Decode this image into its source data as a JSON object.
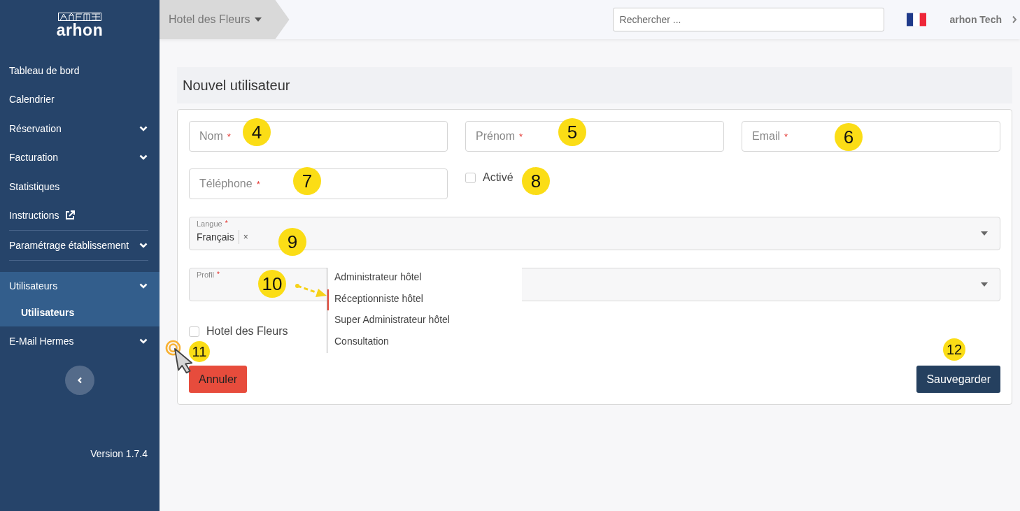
{
  "sidebar": {
    "logo": "arhon",
    "items": [
      {
        "label": "Tableau de bord"
      },
      {
        "label": "Calendrier"
      },
      {
        "label": "Réservation",
        "submenu": true,
        "expanded": false
      },
      {
        "label": "Facturation",
        "submenu": true,
        "expanded": false
      },
      {
        "label": "Statistiques"
      },
      {
        "label": "Instructions",
        "external": true
      },
      {
        "label": "Paramétrage établissement",
        "submenu": true,
        "divider_before": true,
        "expanded": false
      },
      {
        "label": "Utilisateurs",
        "submenu": true,
        "divider_before": true,
        "expanded": true,
        "children": [
          {
            "label": "Utilisateurs",
            "selected": true
          }
        ]
      },
      {
        "label": "E-Mail Hermes",
        "submenu": true,
        "expanded": false
      }
    ],
    "version": "Version 1.7.4"
  },
  "topbar": {
    "hotel": "Hotel des Fleurs",
    "search": {
      "placeholder": "Rechercher ..."
    },
    "user": "arhon Tech"
  },
  "form": {
    "title": "Nouvel utilisateur",
    "fields": [
      {
        "kind": "text",
        "placeholder": "Nom",
        "required_mark": "*"
      },
      {
        "kind": "text",
        "placeholder": "Prénom",
        "required_mark": "*"
      },
      {
        "kind": "text",
        "placeholder": "Email",
        "required_mark": "*"
      },
      {
        "kind": "text",
        "placeholder": "Téléphone",
        "required_mark": "*"
      },
      {
        "kind": "checkbox",
        "label": "Activé",
        "checked": false
      }
    ],
    "language": {
      "label": "Langue",
      "required_mark": "*",
      "tags": [
        {
          "text": "Français",
          "remove": "×"
        }
      ]
    },
    "profile": {
      "label": "Profil",
      "required_mark": "*",
      "expanded": true,
      "options": [
        {
          "label": "Administrateur hôtel",
          "selected": false
        },
        {
          "label": "Réceptionniste hôtel",
          "selected": true
        },
        {
          "label": "Super Administrateur hôtel",
          "selected": false
        },
        {
          "label": "Consultation",
          "selected": false
        }
      ]
    },
    "hotels": [
      {
        "label": "Hotel des Fleurs",
        "checked": false
      }
    ],
    "buttons": {
      "cancel": "Annuler",
      "save": "Sauvegarder"
    }
  },
  "callouts": [
    "4",
    "5",
    "6",
    "7",
    "8",
    "9",
    "10",
    "11",
    "12"
  ]
}
